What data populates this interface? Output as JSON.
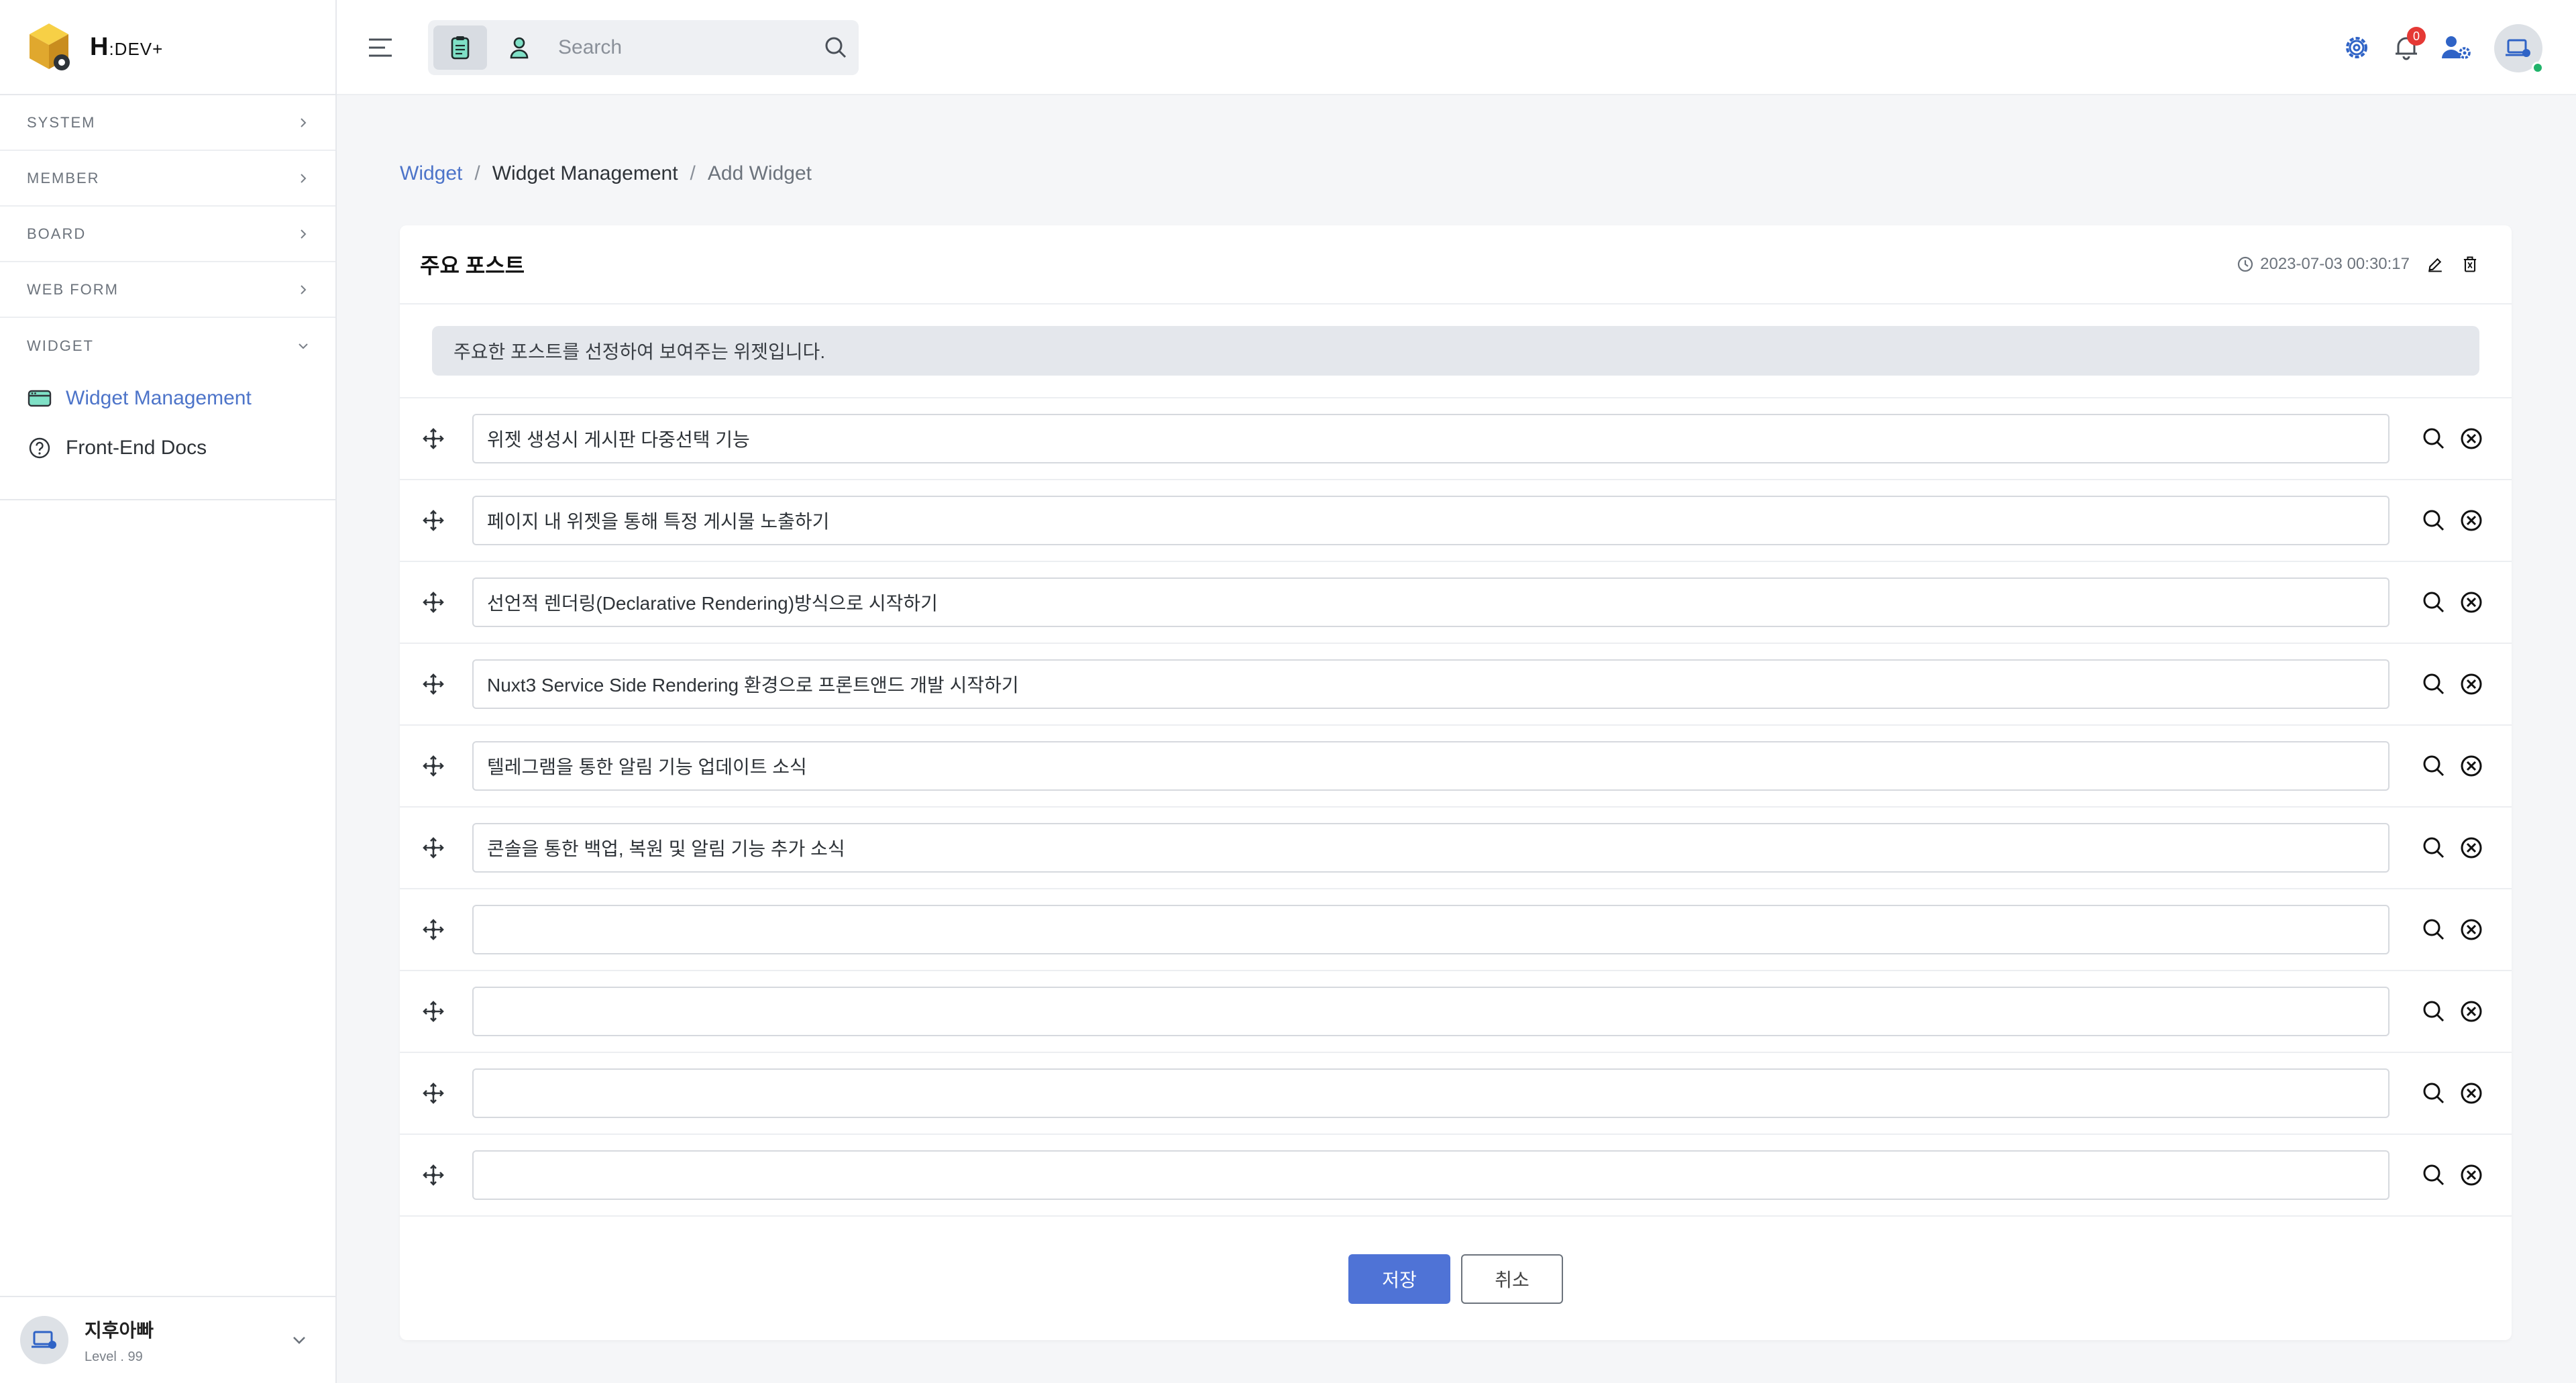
{
  "colors": {
    "accent": "#4d74c9",
    "primary_button": "#4f73d6",
    "badge": "#e53935",
    "online": "#21b36b"
  },
  "brand": {
    "name": "H",
    "suffix": ":DEV+",
    "logo_icon": "cube-gear-logo"
  },
  "sidebar": {
    "sections": [
      {
        "label": "SYSTEM",
        "expanded": false
      },
      {
        "label": "MEMBER",
        "expanded": false
      },
      {
        "label": "BOARD",
        "expanded": false
      },
      {
        "label": "WEB FORM",
        "expanded": false
      },
      {
        "label": "WIDGET",
        "expanded": true
      }
    ],
    "widget_items": [
      {
        "label": "Widget Management",
        "icon": "widget-icon",
        "active": true
      },
      {
        "label": "Front-End Docs",
        "icon": "question-circle-icon",
        "active": false
      }
    ]
  },
  "user": {
    "name": "지후아빠",
    "level": "Level . 99"
  },
  "topbar": {
    "search_placeholder": "Search",
    "notification_count": "0"
  },
  "breadcrumb": {
    "root": "Widget",
    "section": "Widget Management",
    "current": "Add Widget"
  },
  "card": {
    "title": "주요 포스트",
    "timestamp": "2023-07-03 00:30:17",
    "description": "주요한 포스트를 선정하여 보여주는 위젯입니다.",
    "rows": [
      {
        "value": "위젯 생성시 게시판 다중선택 기능"
      },
      {
        "value": "페이지 내 위젯을 통해 특정 게시물 노출하기"
      },
      {
        "value": "선언적 렌더링(Declarative Rendering)방식으로 시작하기"
      },
      {
        "value": "Nuxt3 Service Side Rendering 환경으로 프론트앤드 개발 시작하기"
      },
      {
        "value": "텔레그램을 통한 알림 기능 업데이트 소식"
      },
      {
        "value": "콘솔을 통한 백업, 복원 및 알림 기능 추가 소식"
      },
      {
        "value": ""
      },
      {
        "value": ""
      },
      {
        "value": ""
      },
      {
        "value": ""
      }
    ]
  },
  "buttons": {
    "save": "저장",
    "cancel": "취소"
  }
}
